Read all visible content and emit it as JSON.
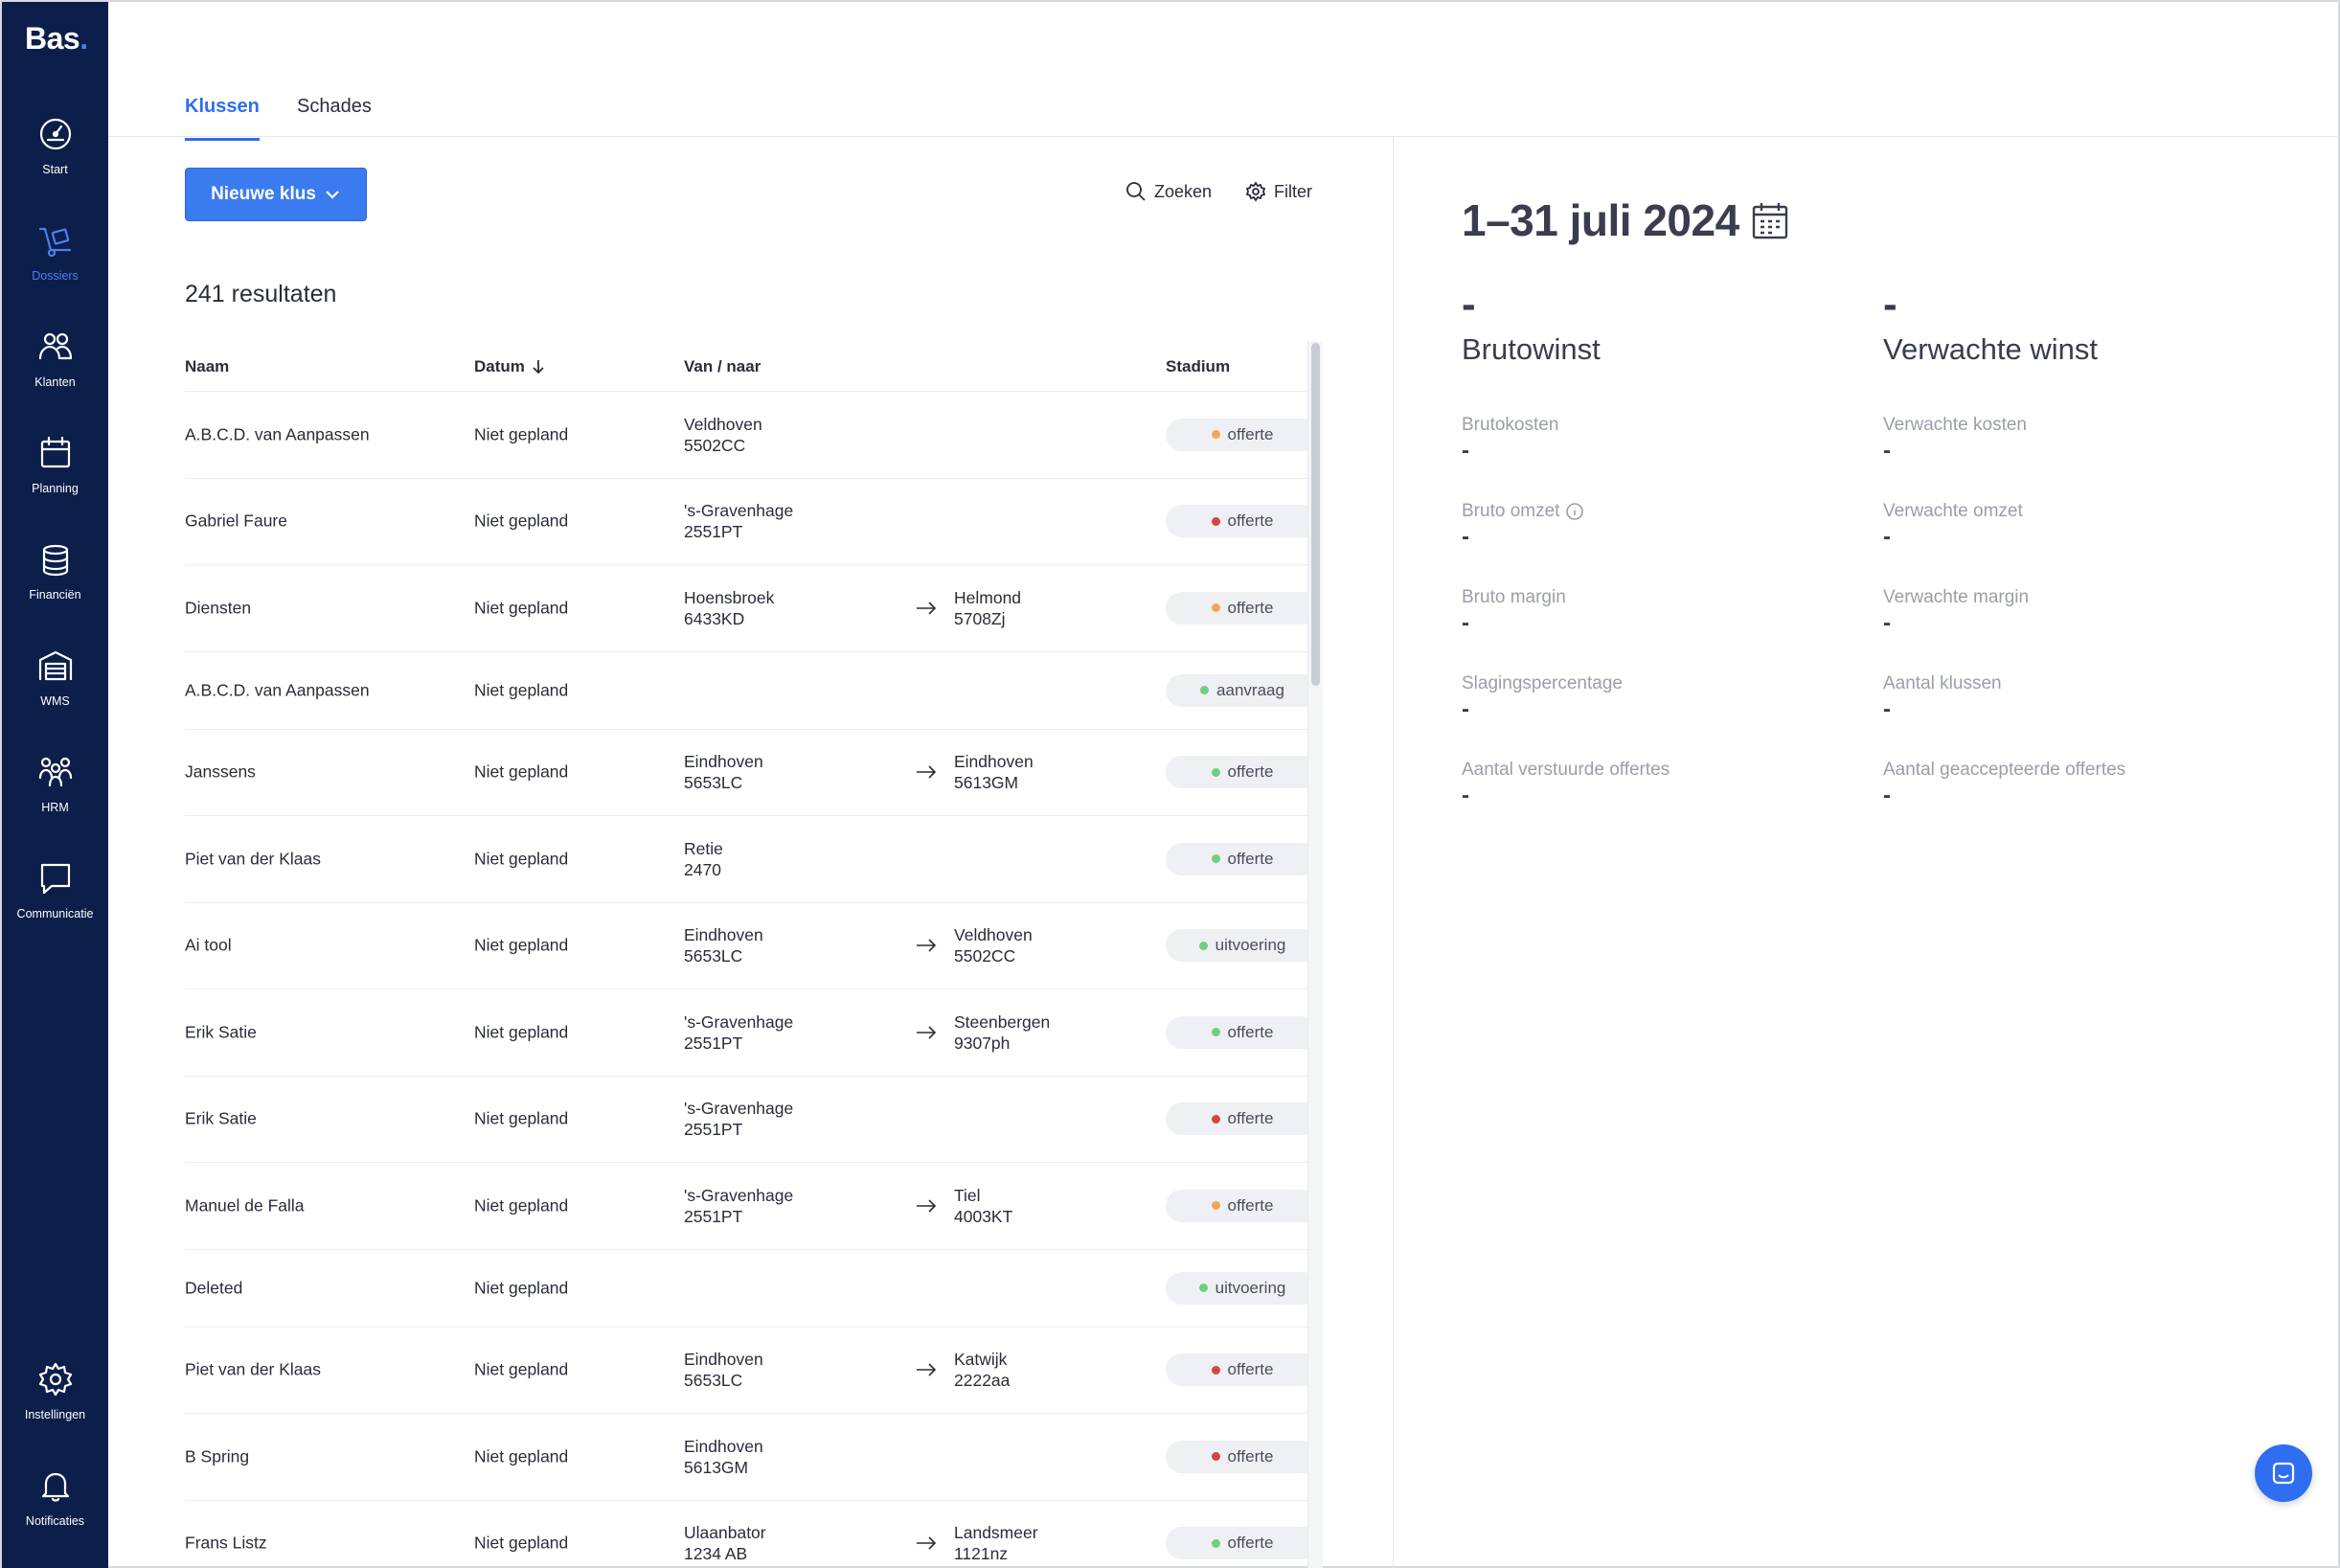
{
  "app": {
    "logo": "Bas",
    "logo_dot": "."
  },
  "sidebar": {
    "items": [
      {
        "label": "Start",
        "icon": "gauge-icon",
        "active": false
      },
      {
        "label": "Dossiers",
        "icon": "dolly-icon",
        "active": true
      },
      {
        "label": "Klanten",
        "icon": "users-icon",
        "active": false
      },
      {
        "label": "Planning",
        "icon": "calendar-icon",
        "active": false
      },
      {
        "label": "Financiën",
        "icon": "coins-icon",
        "active": false
      },
      {
        "label": "WMS",
        "icon": "warehouse-icon",
        "active": false
      },
      {
        "label": "HRM",
        "icon": "team-icon",
        "active": false
      },
      {
        "label": "Communicatie",
        "icon": "chat-icon",
        "active": false
      },
      {
        "label": "Instellingen",
        "icon": "gear-icon",
        "active": false
      },
      {
        "label": "Notificaties",
        "icon": "bell-icon",
        "active": false
      }
    ]
  },
  "tabs": [
    {
      "label": "Klussen",
      "active": true
    },
    {
      "label": "Schades",
      "active": false
    }
  ],
  "toolbar": {
    "new_button": "Nieuwe klus",
    "search": "Zoeken",
    "filter": "Filter"
  },
  "results_label": "241 resultaten",
  "table": {
    "columns": {
      "name": "Naam",
      "date": "Datum",
      "route": "Van / naar",
      "stage": "Stadium"
    },
    "rows": [
      {
        "name": "A.B.C.D. van Aanpassen",
        "date": "Niet gepland",
        "from_city": "Veldhoven",
        "from_zip": "5502CC",
        "to_city": "",
        "to_zip": "",
        "stage": "offerte",
        "status_color": "#f2a65a"
      },
      {
        "name": "Gabriel Faure",
        "date": "Niet gepland",
        "from_city": "'s-Gravenhage",
        "from_zip": "2551PT",
        "to_city": "",
        "to_zip": "",
        "stage": "offerte",
        "status_color": "#d64545"
      },
      {
        "name": "Diensten",
        "date": "Niet gepland",
        "from_city": "Hoensbroek",
        "from_zip": "6433KD",
        "to_city": "Helmond",
        "to_zip": "5708Zj",
        "stage": "offerte",
        "status_color": "#f2a65a"
      },
      {
        "name": "A.B.C.D. van Aanpassen",
        "date": "Niet gepland",
        "from_city": "",
        "from_zip": "",
        "to_city": "",
        "to_zip": "",
        "stage": "aanvraag",
        "status_color": "#6fcf7f"
      },
      {
        "name": "Janssens",
        "date": "Niet gepland",
        "from_city": "Eindhoven",
        "from_zip": "5653LC",
        "to_city": "Eindhoven",
        "to_zip": "5613GM",
        "stage": "offerte",
        "status_color": "#6fcf7f"
      },
      {
        "name": "Piet van der Klaas",
        "date": "Niet gepland",
        "from_city": "Retie",
        "from_zip": "2470",
        "to_city": "",
        "to_zip": "",
        "stage": "offerte",
        "status_color": "#6fcf7f"
      },
      {
        "name": "Ai tool",
        "date": "Niet gepland",
        "from_city": "Eindhoven",
        "from_zip": "5653LC",
        "to_city": "Veldhoven",
        "to_zip": "5502CC",
        "stage": "uitvoering",
        "status_color": "#6fcf7f"
      },
      {
        "name": "Erik Satie",
        "date": "Niet gepland",
        "from_city": "'s-Gravenhage",
        "from_zip": "2551PT",
        "to_city": "Steenbergen",
        "to_zip": "9307ph",
        "stage": "offerte",
        "status_color": "#6fcf7f"
      },
      {
        "name": "Erik Satie",
        "date": "Niet gepland",
        "from_city": "'s-Gravenhage",
        "from_zip": "2551PT",
        "to_city": "",
        "to_zip": "",
        "stage": "offerte",
        "status_color": "#d64545"
      },
      {
        "name": "Manuel de Falla",
        "date": "Niet gepland",
        "from_city": "'s-Gravenhage",
        "from_zip": "2551PT",
        "to_city": "Tiel",
        "to_zip": "4003KT",
        "stage": "offerte",
        "status_color": "#f2a65a"
      },
      {
        "name": "Deleted",
        "date": "Niet gepland",
        "from_city": "",
        "from_zip": "",
        "to_city": "",
        "to_zip": "",
        "stage": "uitvoering",
        "status_color": "#6fcf7f"
      },
      {
        "name": "Piet van der Klaas",
        "date": "Niet gepland",
        "from_city": "Eindhoven",
        "from_zip": "5653LC",
        "to_city": "Katwijk",
        "to_zip": "2222aa",
        "stage": "offerte",
        "status_color": "#d64545"
      },
      {
        "name": "B Spring",
        "date": "Niet gepland",
        "from_city": "Eindhoven",
        "from_zip": "5613GM",
        "to_city": "",
        "to_zip": "",
        "stage": "offerte",
        "status_color": "#d64545"
      },
      {
        "name": "Frans Listz",
        "date": "Niet gepland",
        "from_city": "Ulaanbator",
        "from_zip": "1234 AB",
        "to_city": "Landsmeer",
        "to_zip": "1121nz",
        "stage": "offerte",
        "status_color": "#6fcf7f"
      }
    ]
  },
  "stats": {
    "period": "1–31 juli 2024",
    "left": {
      "value": "-",
      "title": "Brutowinst",
      "metrics": [
        {
          "label": "Brutokosten",
          "value": "-",
          "info": false
        },
        {
          "label": "Bruto omzet",
          "value": "-",
          "info": true
        },
        {
          "label": "Bruto margin",
          "value": "-",
          "info": false
        },
        {
          "label": "Slagingspercentage",
          "value": "-",
          "info": false
        },
        {
          "label": "Aantal verstuurde offertes",
          "value": "-",
          "info": false
        }
      ]
    },
    "right": {
      "value": "-",
      "title": "Verwachte winst",
      "metrics": [
        {
          "label": "Verwachte kosten",
          "value": "-"
        },
        {
          "label": "Verwachte omzet",
          "value": "-"
        },
        {
          "label": "Verwachte margin",
          "value": "-"
        },
        {
          "label": "Aantal klussen",
          "value": "-"
        },
        {
          "label": "Aantal geaccepteerde offertes",
          "value": "-"
        }
      ]
    }
  },
  "colors": {
    "accent": "#2f6ef0",
    "sidebar": "#0c1f4a"
  }
}
